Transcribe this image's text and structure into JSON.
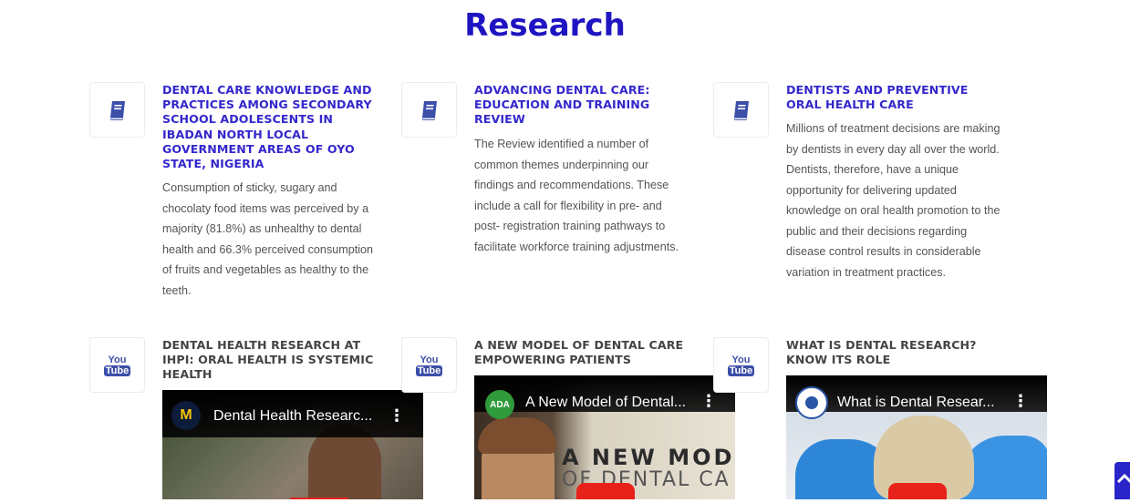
{
  "section": {
    "title": "Research"
  },
  "cards": [
    {
      "title": "DENTAL CARE KNOWLEDGE AND PRACTICES AMONG SECONDARY SCHOOL ADOLESCENTS IN IBADAN NORTH LOCAL GOVERNMENT AREAS OF OYO STATE, NIGERIA",
      "text": "Consumption of sticky, sugary and chocolaty food items was perceived by a majority (81.8%) as unhealthy to dental health and 66.3% perceived consumption of fruits and vegetables as healthy to the teeth.",
      "icon": "book-icon"
    },
    {
      "title": "ADVANCING DENTAL CARE: EDUCATION AND TRAINING REVIEW",
      "text": "The Review identified a number of common themes underpinning our findings and recommendations. These include a call for flexibility in pre- and post- registration training pathways to facilitate workforce training adjustments.",
      "icon": "book-icon"
    },
    {
      "title": "DENTISTS AND PREVENTIVE ORAL HEALTH CARE",
      "text": "Millions of treatment decisions are making by dentists in every day all over the world. Dentists, therefore, have a unique opportunity for delivering updated knowledge on oral health promotion to the public and their decisions regarding disease control results in considerable variation in treatment practices.",
      "icon": "book-icon"
    }
  ],
  "videos": [
    {
      "title": "DENTAL HEALTH RESEARCH AT IHPI: ORAL HEALTH IS SYSTEMIC HEALTH",
      "video_title": "Dental Health Researc...",
      "overlay_text": "",
      "icon_label": {
        "top": "You",
        "bottom": "Tube"
      }
    },
    {
      "title": "A NEW MODEL OF DENTAL CARE EMPOWERING PATIENTS",
      "video_title": "A New Model of Dental...",
      "channel": "ADA",
      "overlay_line1": "A NEW MOD",
      "overlay_line2": "OF DENTAL CA",
      "icon_label": {
        "top": "You",
        "bottom": "Tube"
      }
    },
    {
      "title": "WHAT IS DENTAL RESEARCH? KNOW ITS ROLE",
      "video_title": "What is Dental Resear...",
      "icon_label": {
        "top": "You",
        "bottom": "Tube"
      }
    }
  ],
  "colors": {
    "heading": "#1f14c2",
    "card_title": "#3427cc",
    "text": "#545454",
    "icon": "#3d4fa8",
    "play": "#e8221b"
  }
}
